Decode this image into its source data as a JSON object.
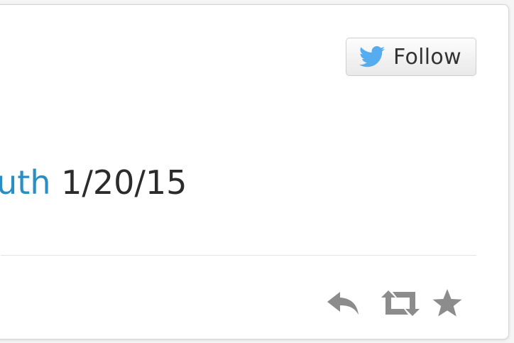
{
  "follow_button": {
    "label": "Follow",
    "icon": "twitter-bird-icon"
  },
  "tweet": {
    "link_text": "outh",
    "date": " 1/20/15"
  },
  "actions": [
    {
      "name": "reply",
      "icon": "reply-icon"
    },
    {
      "name": "retweet",
      "icon": "retweet-icon"
    },
    {
      "name": "favorite",
      "icon": "star-icon"
    }
  ],
  "colors": {
    "link": "#2b8ec2",
    "twitter_blue": "#55acee",
    "action_gray": "#8c8c8c"
  }
}
